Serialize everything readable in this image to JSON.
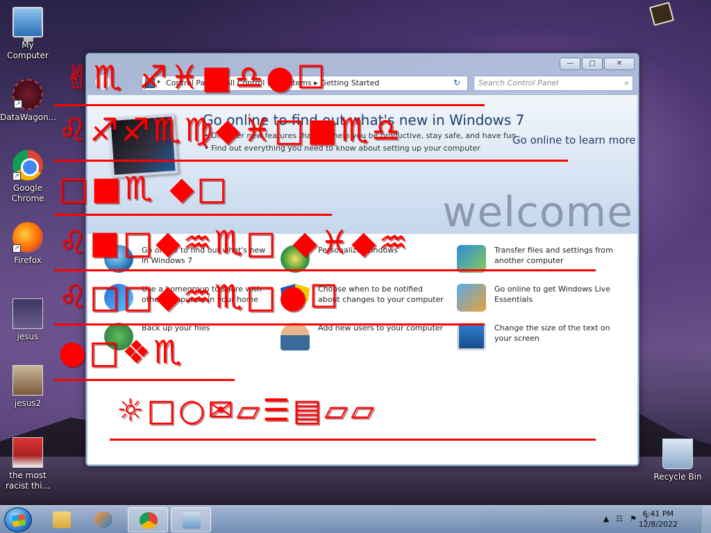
{
  "desktop": {
    "icons": [
      {
        "label": "My Computer"
      },
      {
        "label": "DataWagon..."
      },
      {
        "label": "Google Chrome"
      },
      {
        "label": "Firefox"
      },
      {
        "label": "jesus"
      },
      {
        "label": "jesus2"
      },
      {
        "label": "the most racist thi..."
      },
      {
        "label": "Recycle Bin"
      }
    ]
  },
  "window": {
    "address": {
      "segments": "Control Panel  ▸  All Control Panel Items  ▸  Getting Started",
      "refresh_glyph": "↻"
    },
    "search": {
      "placeholder": "Search Control Panel",
      "icon": "search-icon"
    },
    "controls": {
      "minimize": "—",
      "maximize": "□",
      "close": "✕"
    },
    "banner": {
      "title": "Go online to find out what's new in Windows 7",
      "bullets": [
        "• Discover new features that can help you be productive, stay safe, and have fun",
        "• Find out everything you need to know about setting up your computer"
      ],
      "link": "Go online to learn more",
      "watermark": "welcome"
    },
    "tasks": [
      {
        "label": "Go online to find out what's new in Windows 7",
        "icon": "globe-icon"
      },
      {
        "label": "Personalize Windows",
        "icon": "paint-icon"
      },
      {
        "label": "Transfer files and settings from another computer",
        "icon": "transfer-icon"
      },
      {
        "label": "Use a homegroup to share with other computers in your home",
        "icon": "homegroup-icon"
      },
      {
        "label": "Choose when to be notified about changes to your computer",
        "icon": "shield-icon"
      },
      {
        "label": "Go online to get Windows Live Essentials",
        "icon": "live-icon"
      },
      {
        "label": "Back up your files",
        "icon": "backup-icon"
      },
      {
        "label": "Add new users to your computer",
        "icon": "users-icon"
      },
      {
        "label": "Change the size of the text on your screen",
        "icon": "screen-icon"
      }
    ]
  },
  "overlay": {
    "lines": [
      "✌♏  ♐♓■♎●☐",
      "♌♐♐♏♍◆♓□■♏♎",
      "□■♏  ◆□",
      "♌■□◆♒♏□  ◆♓◆♒",
      "♌□□◆♒♏□●☐",
      "●□❖♏",
      "☼□○✉▱☰▤▱▱"
    ]
  },
  "taskbar": {
    "clock_time": "6:41 PM",
    "clock_date": "12/8/2022",
    "tray_icons": [
      "▲",
      "☷",
      "⚑",
      "♪"
    ]
  },
  "colors": {
    "overlay_red": "#ff0000",
    "window_frame": "#5c7ea8"
  }
}
